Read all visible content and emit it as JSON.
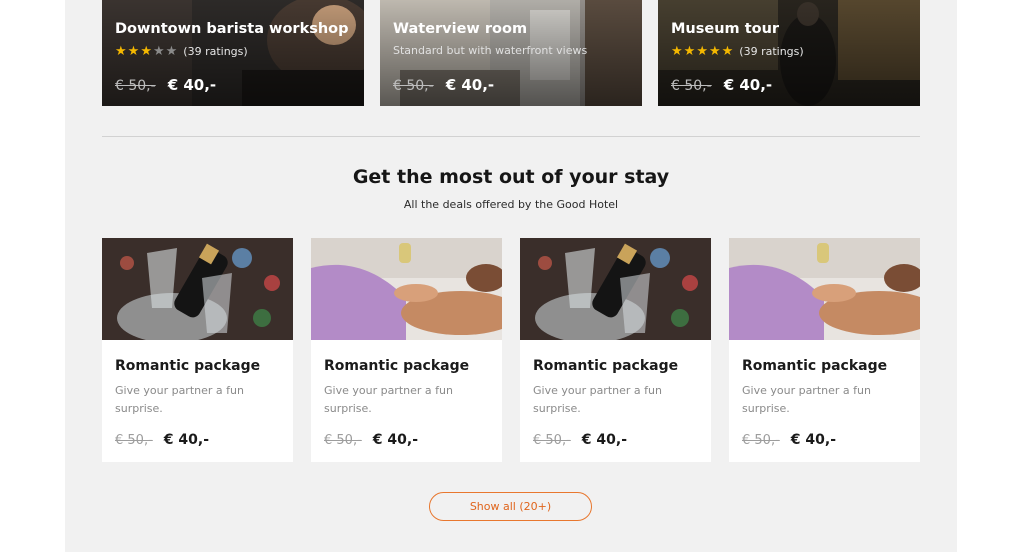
{
  "experiences": [
    {
      "title": "Downtown barista workshop",
      "rating_text": "(39 ratings)",
      "stars": 3,
      "old_price": "€ 50,-",
      "new_price": "€ 40,-"
    },
    {
      "title": "Waterview room",
      "subtitle": "Standard but with waterfront views",
      "old_price": "€ 50,-",
      "new_price": "€ 40,-"
    },
    {
      "title": "Museum tour",
      "rating_text": "(39 ratings)",
      "stars": 5,
      "old_price": "€ 50,-",
      "new_price": "€ 40,-"
    }
  ],
  "section": {
    "title": "Get the most out of your stay",
    "subtitle": "All the deals offered by the Good Hotel"
  },
  "deals": [
    {
      "image": "champagne-image",
      "title": "Romantic package",
      "description": "Give your partner a fun surprise.",
      "old_price": "€ 50,-",
      "new_price": "€ 40,-"
    },
    {
      "image": "massage-image",
      "title": "Romantic package",
      "description": "Give your partner a fun surprise.",
      "old_price": "€ 50,-",
      "new_price": "€ 40,-"
    },
    {
      "image": "champagne-image",
      "title": "Romantic package",
      "description": "Give your partner a fun surprise.",
      "old_price": "€ 50,-",
      "new_price": "€ 40,-"
    },
    {
      "image": "massage-image",
      "title": "Romantic package",
      "description": "Give your partner a fun surprise.",
      "old_price": "€ 50,-",
      "new_price": "€ 40,-"
    }
  ],
  "show_all_label": "Show all (20+)",
  "colors": {
    "accent": "#e8772e",
    "star": "#f5b800",
    "panel": "#f1f1f1"
  }
}
